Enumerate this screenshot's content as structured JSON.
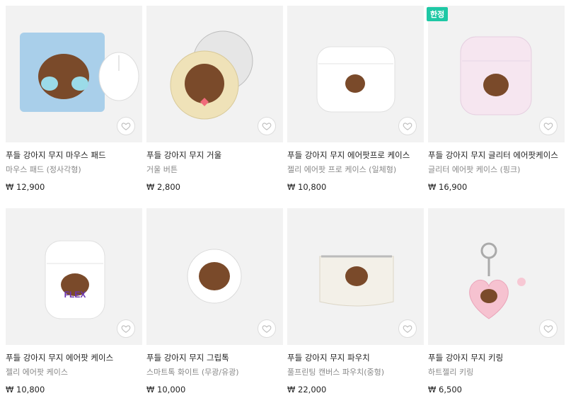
{
  "products": [
    {
      "title": "푸들 강아지 무지 마우스 패드",
      "subtitle": "마우스 패드 (정사각형)",
      "price": "₩ 12,900",
      "badge": "",
      "art": "mousepad-icon"
    },
    {
      "title": "푸들 강아지 무지 거울",
      "subtitle": "거울 버튼",
      "price": "₩ 2,800",
      "badge": "",
      "art": "mirror-icon"
    },
    {
      "title": "푸들 강아지 무지 에어팟프로 케이스",
      "subtitle": "젤리 에어팟 프로 케이스 (일체형)",
      "price": "₩ 10,800",
      "badge": "",
      "art": "airpods-pro-case-icon"
    },
    {
      "title": "푸들 강아지 무지 글리터 에어팟케이스",
      "subtitle": "글리터 에어팟 케이스 (핑크)",
      "price": "₩ 16,900",
      "badge": "한정",
      "art": "glitter-airpods-case-icon"
    },
    {
      "title": "푸들 강아지 무지 에어팟 케이스",
      "subtitle": "젤리 에어팟 케이스",
      "price": "₩ 10,800",
      "badge": "",
      "art": "airpods-case-icon",
      "flex_text": "FLEX"
    },
    {
      "title": "푸들 강아지 무지 그립톡",
      "subtitle": "스마트톡 화이트 (무광/유광)",
      "price": "₩ 10,000",
      "badge": "",
      "art": "griptok-icon"
    },
    {
      "title": "푸들 강아지 무지 파우치",
      "subtitle": "풀프린팅 캔버스 파우치(중형)",
      "price": "₩ 22,000",
      "badge": "",
      "art": "pouch-icon"
    },
    {
      "title": "푸들 강아지 무지 키링",
      "subtitle": "하트젤리 키링",
      "price": "₩ 6,500",
      "badge": "",
      "art": "keyring-icon"
    }
  ],
  "colors": {
    "badge": "#1ec8a5",
    "thumb_bg": "#f2f2f2",
    "dog": "#7a4a2a",
    "title": "#222222",
    "subtitle": "#888888"
  }
}
